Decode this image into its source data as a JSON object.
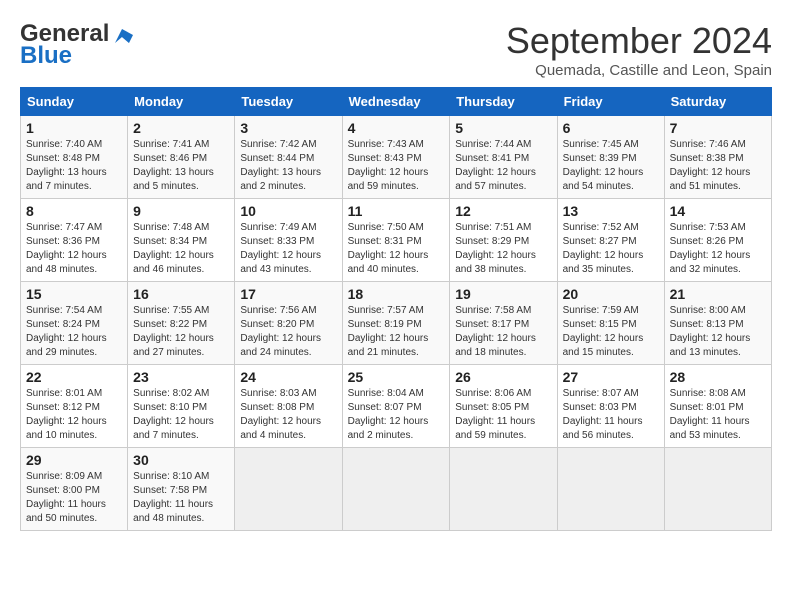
{
  "header": {
    "logo_line1": "General",
    "logo_line2": "Blue",
    "month": "September 2024",
    "location": "Quemada, Castille and Leon, Spain"
  },
  "weekdays": [
    "Sunday",
    "Monday",
    "Tuesday",
    "Wednesday",
    "Thursday",
    "Friday",
    "Saturday"
  ],
  "weeks": [
    [
      {
        "day": "1",
        "sunrise": "7:40 AM",
        "sunset": "8:48 PM",
        "daylight": "13 hours and 7 minutes."
      },
      {
        "day": "2",
        "sunrise": "7:41 AM",
        "sunset": "8:46 PM",
        "daylight": "13 hours and 5 minutes."
      },
      {
        "day": "3",
        "sunrise": "7:42 AM",
        "sunset": "8:44 PM",
        "daylight": "13 hours and 2 minutes."
      },
      {
        "day": "4",
        "sunrise": "7:43 AM",
        "sunset": "8:43 PM",
        "daylight": "12 hours and 59 minutes."
      },
      {
        "day": "5",
        "sunrise": "7:44 AM",
        "sunset": "8:41 PM",
        "daylight": "12 hours and 57 minutes."
      },
      {
        "day": "6",
        "sunrise": "7:45 AM",
        "sunset": "8:39 PM",
        "daylight": "12 hours and 54 minutes."
      },
      {
        "day": "7",
        "sunrise": "7:46 AM",
        "sunset": "8:38 PM",
        "daylight": "12 hours and 51 minutes."
      }
    ],
    [
      {
        "day": "8",
        "sunrise": "7:47 AM",
        "sunset": "8:36 PM",
        "daylight": "12 hours and 48 minutes."
      },
      {
        "day": "9",
        "sunrise": "7:48 AM",
        "sunset": "8:34 PM",
        "daylight": "12 hours and 46 minutes."
      },
      {
        "day": "10",
        "sunrise": "7:49 AM",
        "sunset": "8:33 PM",
        "daylight": "12 hours and 43 minutes."
      },
      {
        "day": "11",
        "sunrise": "7:50 AM",
        "sunset": "8:31 PM",
        "daylight": "12 hours and 40 minutes."
      },
      {
        "day": "12",
        "sunrise": "7:51 AM",
        "sunset": "8:29 PM",
        "daylight": "12 hours and 38 minutes."
      },
      {
        "day": "13",
        "sunrise": "7:52 AM",
        "sunset": "8:27 PM",
        "daylight": "12 hours and 35 minutes."
      },
      {
        "day": "14",
        "sunrise": "7:53 AM",
        "sunset": "8:26 PM",
        "daylight": "12 hours and 32 minutes."
      }
    ],
    [
      {
        "day": "15",
        "sunrise": "7:54 AM",
        "sunset": "8:24 PM",
        "daylight": "12 hours and 29 minutes."
      },
      {
        "day": "16",
        "sunrise": "7:55 AM",
        "sunset": "8:22 PM",
        "daylight": "12 hours and 27 minutes."
      },
      {
        "day": "17",
        "sunrise": "7:56 AM",
        "sunset": "8:20 PM",
        "daylight": "12 hours and 24 minutes."
      },
      {
        "day": "18",
        "sunrise": "7:57 AM",
        "sunset": "8:19 PM",
        "daylight": "12 hours and 21 minutes."
      },
      {
        "day": "19",
        "sunrise": "7:58 AM",
        "sunset": "8:17 PM",
        "daylight": "12 hours and 18 minutes."
      },
      {
        "day": "20",
        "sunrise": "7:59 AM",
        "sunset": "8:15 PM",
        "daylight": "12 hours and 15 minutes."
      },
      {
        "day": "21",
        "sunrise": "8:00 AM",
        "sunset": "8:13 PM",
        "daylight": "12 hours and 13 minutes."
      }
    ],
    [
      {
        "day": "22",
        "sunrise": "8:01 AM",
        "sunset": "8:12 PM",
        "daylight": "12 hours and 10 minutes."
      },
      {
        "day": "23",
        "sunrise": "8:02 AM",
        "sunset": "8:10 PM",
        "daylight": "12 hours and 7 minutes."
      },
      {
        "day": "24",
        "sunrise": "8:03 AM",
        "sunset": "8:08 PM",
        "daylight": "12 hours and 4 minutes."
      },
      {
        "day": "25",
        "sunrise": "8:04 AM",
        "sunset": "8:07 PM",
        "daylight": "12 hours and 2 minutes."
      },
      {
        "day": "26",
        "sunrise": "8:06 AM",
        "sunset": "8:05 PM",
        "daylight": "11 hours and 59 minutes."
      },
      {
        "day": "27",
        "sunrise": "8:07 AM",
        "sunset": "8:03 PM",
        "daylight": "11 hours and 56 minutes."
      },
      {
        "day": "28",
        "sunrise": "8:08 AM",
        "sunset": "8:01 PM",
        "daylight": "11 hours and 53 minutes."
      }
    ],
    [
      {
        "day": "29",
        "sunrise": "8:09 AM",
        "sunset": "8:00 PM",
        "daylight": "11 hours and 50 minutes."
      },
      {
        "day": "30",
        "sunrise": "8:10 AM",
        "sunset": "7:58 PM",
        "daylight": "11 hours and 48 minutes."
      },
      null,
      null,
      null,
      null,
      null
    ]
  ]
}
